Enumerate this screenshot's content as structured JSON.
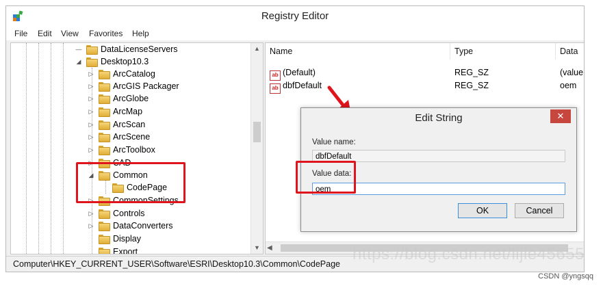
{
  "window": {
    "title": "Registry Editor",
    "menu": [
      "File",
      "Edit",
      "View",
      "Favorites",
      "Help"
    ]
  },
  "tree": {
    "items": [
      {
        "label": "DataLicenseServers",
        "expander": "—"
      },
      {
        "label": "Desktop10.3",
        "expander": "◢"
      },
      {
        "label": "ArcCatalog",
        "expander": "▷"
      },
      {
        "label": "ArcGIS Packager",
        "expander": "▷"
      },
      {
        "label": "ArcGlobe",
        "expander": "▷"
      },
      {
        "label": "ArcMap",
        "expander": "▷"
      },
      {
        "label": "ArcScan",
        "expander": "▷"
      },
      {
        "label": "ArcScene",
        "expander": "▷"
      },
      {
        "label": "ArcToolbox",
        "expander": "▷"
      },
      {
        "label": "CAD",
        "expander": "▷"
      },
      {
        "label": "Common",
        "expander": "◢"
      },
      {
        "label": "CodePage",
        "expander": ""
      },
      {
        "label": "CommonSettings",
        "expander": "▷"
      },
      {
        "label": "Controls",
        "expander": "▷"
      },
      {
        "label": "DataConverters",
        "expander": "▷"
      },
      {
        "label": "Display",
        "expander": ""
      },
      {
        "label": "Export",
        "expander": ""
      }
    ]
  },
  "list": {
    "columns": [
      "Name",
      "Type",
      "Data"
    ],
    "rows": [
      {
        "name": "(Default)",
        "type": "REG_SZ",
        "data": "(value n"
      },
      {
        "name": "dbfDefault",
        "type": "REG_SZ",
        "data": "oem"
      }
    ]
  },
  "statusbar": {
    "path": "Computer\\HKEY_CURRENT_USER\\Software\\ESRI\\Desktop10.3\\Common\\CodePage"
  },
  "dialog": {
    "title": "Edit String",
    "close_icon": "✕",
    "value_name_label": "Value name:",
    "value_name": "dbfDefault",
    "value_data_label": "Value data:",
    "value_data": "oem",
    "ok_label": "OK",
    "cancel_label": "Cancel"
  },
  "overlay": {
    "watermark": "https://blog.csdn.net/lijie45655",
    "credit": "CSDN @yngsqq",
    "highlight_color": "#e0141c"
  },
  "icons": {
    "reg_string": "ab"
  }
}
